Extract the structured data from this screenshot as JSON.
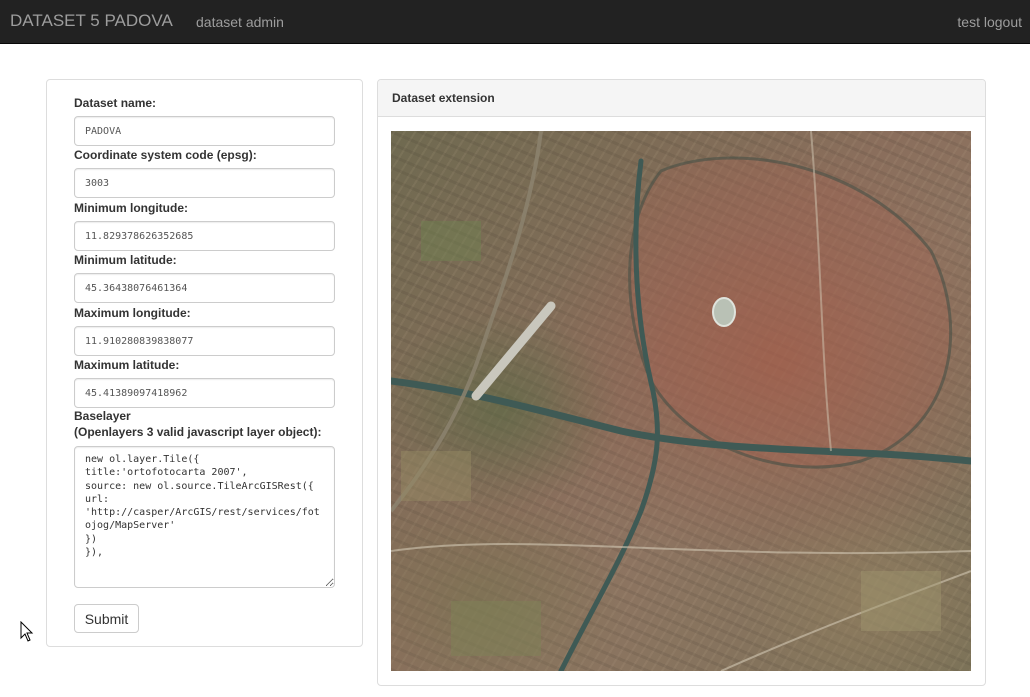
{
  "navbar": {
    "brand": "DATASET 5 PADOVA",
    "admin_link": "dataset admin",
    "logout_link": "test logout"
  },
  "form": {
    "dataset_name_label": "Dataset name:",
    "dataset_name_value": "PADOVA",
    "epsg_label": "Coordinate system code (epsg):",
    "epsg_value": "3003",
    "min_lon_label": "Minimum longitude:",
    "min_lon_value": "11.829378626352685",
    "min_lat_label": "Minimum latitude:",
    "min_lat_value": "45.36438076461364",
    "max_lon_label": "Maximum longitude:",
    "max_lon_value": "11.910280839838077",
    "max_lat_label": "Maximum latitude:",
    "max_lat_value": "45.41389097418962",
    "baselayer_label_1": "Baselayer",
    "baselayer_label_2": "(Openlayers 3 valid javascript layer object):",
    "baselayer_value": "new ol.layer.Tile({\ntitle:'ortofotocarta 2007',\nsource: new ol.source.TileArcGISRest({\nurl:\n'http://casper/ArcGIS/rest/services/fotojog/MapServer'\n})\n}),",
    "submit_label": "Submit"
  },
  "map_panel": {
    "title": "Dataset extension",
    "map_description": "aerial orthophoto of Padova"
  },
  "colors": {
    "navbar_bg": "#222222",
    "navbar_text": "#9d9d9d",
    "panel_border": "#dddddd",
    "panel_heading_bg": "#f5f5f5",
    "river": "#3f5a55"
  },
  "icons": {
    "cursor": "mouse-pointer-icon"
  }
}
